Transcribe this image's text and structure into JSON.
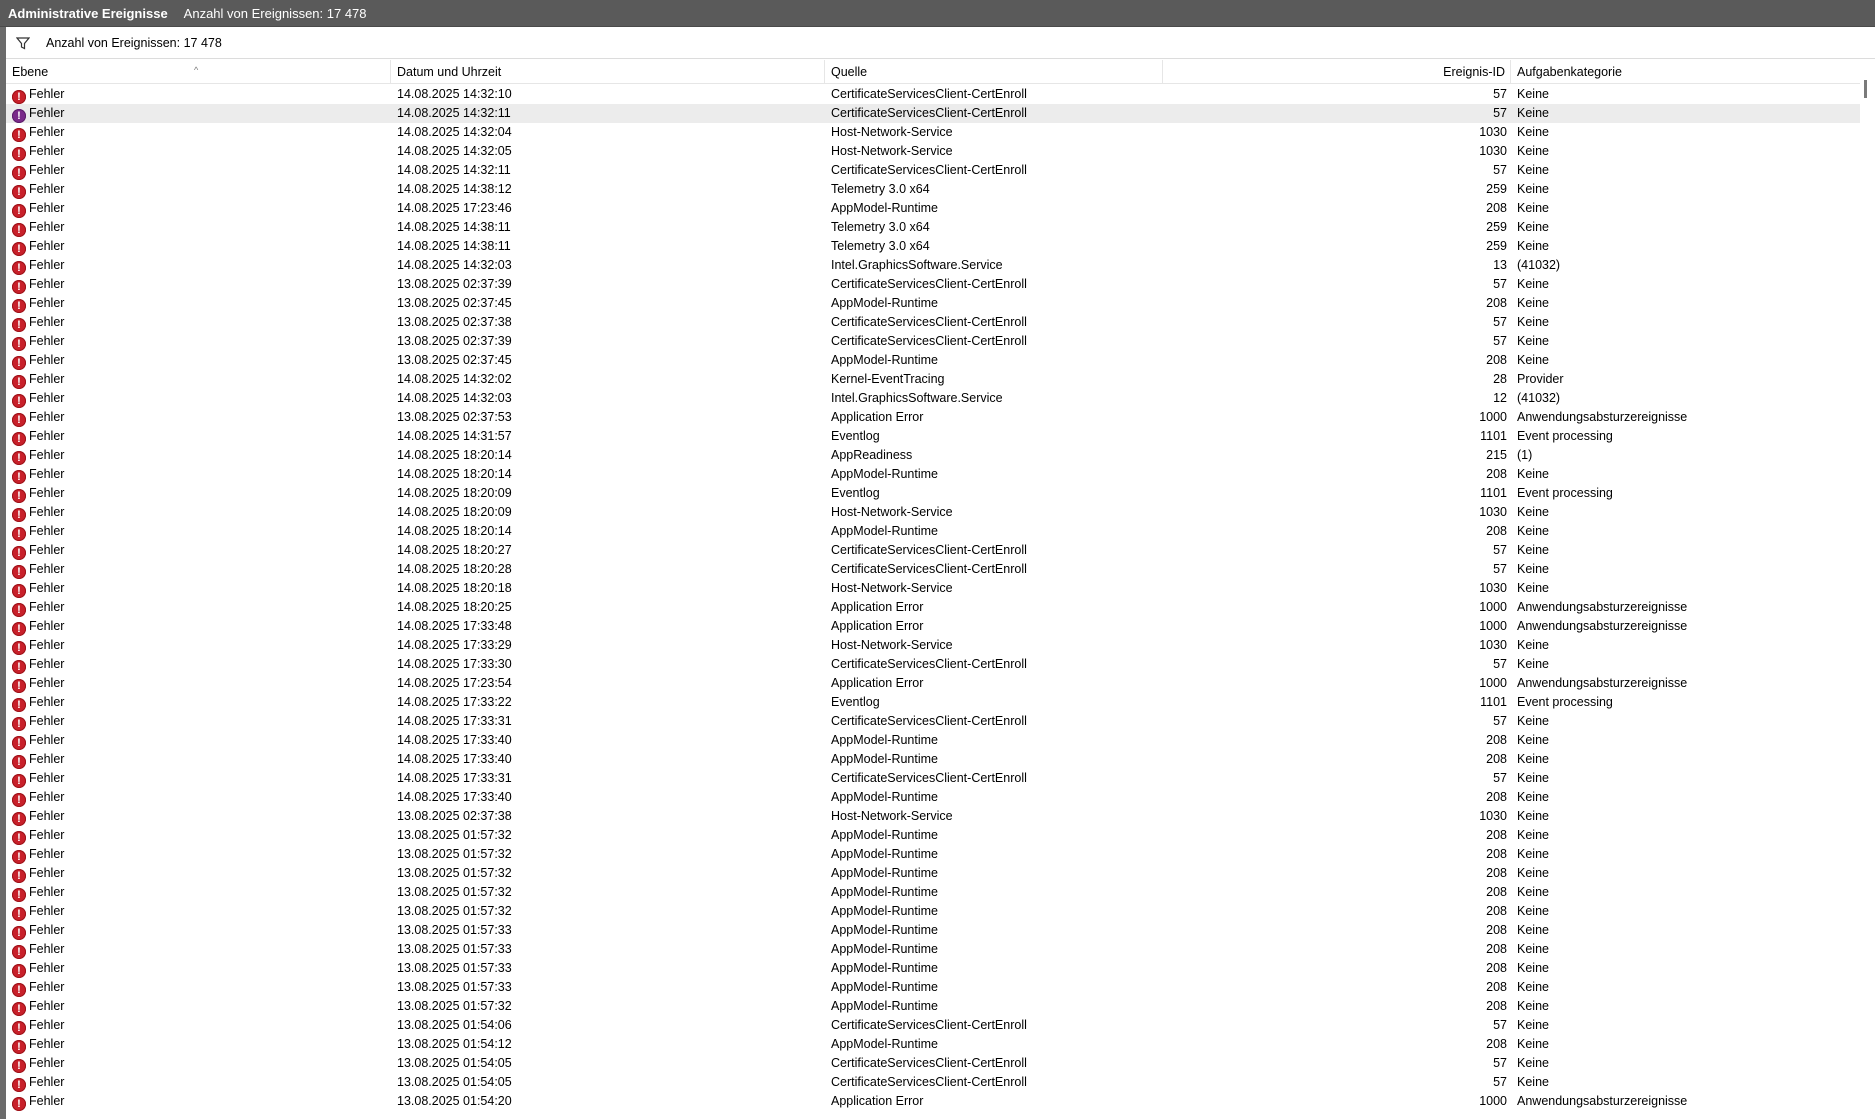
{
  "title_bar": {
    "title": "Administrative Ereignisse",
    "count_label": "Anzahl von Ereignissen: 17 478"
  },
  "filter_bar": {
    "icon": "filter-icon",
    "text": "Anzahl von Ereignissen: 17 478"
  },
  "columns": [
    "Ebene",
    "Datum und Uhrzeit",
    "Quelle",
    "Ereignis-ID",
    "Aufgabenkategorie"
  ],
  "rows": [
    {
      "level": "Fehler",
      "date": "14.08.2025 14:32:10",
      "source": "CertificateServicesClient-CertEnroll",
      "id": "57",
      "category": "Keine"
    },
    {
      "level": "Fehler",
      "date": "14.08.2025 14:32:11",
      "source": "CertificateServicesClient-CertEnroll",
      "id": "57",
      "category": "Keine"
    },
    {
      "level": "Fehler",
      "date": "14.08.2025 14:32:04",
      "source": "Host-Network-Service",
      "id": "1030",
      "category": "Keine"
    },
    {
      "level": "Fehler",
      "date": "14.08.2025 14:32:05",
      "source": "Host-Network-Service",
      "id": "1030",
      "category": "Keine"
    },
    {
      "level": "Fehler",
      "date": "14.08.2025 14:32:11",
      "source": "CertificateServicesClient-CertEnroll",
      "id": "57",
      "category": "Keine"
    },
    {
      "level": "Fehler",
      "date": "14.08.2025 14:38:12",
      "source": "Telemetry 3.0 x64",
      "id": "259",
      "category": "Keine"
    },
    {
      "level": "Fehler",
      "date": "14.08.2025 17:23:46",
      "source": "AppModel-Runtime",
      "id": "208",
      "category": "Keine"
    },
    {
      "level": "Fehler",
      "date": "14.08.2025 14:38:11",
      "source": "Telemetry 3.0 x64",
      "id": "259",
      "category": "Keine"
    },
    {
      "level": "Fehler",
      "date": "14.08.2025 14:38:11",
      "source": "Telemetry 3.0 x64",
      "id": "259",
      "category": "Keine"
    },
    {
      "level": "Fehler",
      "date": "14.08.2025 14:32:03",
      "source": "Intel.GraphicsSoftware.Service",
      "id": "13",
      "category": "(41032)"
    },
    {
      "level": "Fehler",
      "date": "13.08.2025 02:37:39",
      "source": "CertificateServicesClient-CertEnroll",
      "id": "57",
      "category": "Keine"
    },
    {
      "level": "Fehler",
      "date": "13.08.2025 02:37:45",
      "source": "AppModel-Runtime",
      "id": "208",
      "category": "Keine"
    },
    {
      "level": "Fehler",
      "date": "13.08.2025 02:37:38",
      "source": "CertificateServicesClient-CertEnroll",
      "id": "57",
      "category": "Keine"
    },
    {
      "level": "Fehler",
      "date": "13.08.2025 02:37:39",
      "source": "CertificateServicesClient-CertEnroll",
      "id": "57",
      "category": "Keine"
    },
    {
      "level": "Fehler",
      "date": "13.08.2025 02:37:45",
      "source": "AppModel-Runtime",
      "id": "208",
      "category": "Keine"
    },
    {
      "level": "Fehler",
      "date": "14.08.2025 14:32:02",
      "source": "Kernel-EventTracing",
      "id": "28",
      "category": "Provider"
    },
    {
      "level": "Fehler",
      "date": "14.08.2025 14:32:03",
      "source": "Intel.GraphicsSoftware.Service",
      "id": "12",
      "category": "(41032)"
    },
    {
      "level": "Fehler",
      "date": "13.08.2025 02:37:53",
      "source": "Application Error",
      "id": "1000",
      "category": "Anwendungsabsturzereignisse"
    },
    {
      "level": "Fehler",
      "date": "14.08.2025 14:31:57",
      "source": "Eventlog",
      "id": "1101",
      "category": "Event processing"
    },
    {
      "level": "Fehler",
      "date": "14.08.2025 18:20:14",
      "source": "AppReadiness",
      "id": "215",
      "category": "(1)"
    },
    {
      "level": "Fehler",
      "date": "14.08.2025 18:20:14",
      "source": "AppModel-Runtime",
      "id": "208",
      "category": "Keine"
    },
    {
      "level": "Fehler",
      "date": "14.08.2025 18:20:09",
      "source": "Eventlog",
      "id": "1101",
      "category": "Event processing"
    },
    {
      "level": "Fehler",
      "date": "14.08.2025 18:20:09",
      "source": "Host-Network-Service",
      "id": "1030",
      "category": "Keine"
    },
    {
      "level": "Fehler",
      "date": "14.08.2025 18:20:14",
      "source": "AppModel-Runtime",
      "id": "208",
      "category": "Keine"
    },
    {
      "level": "Fehler",
      "date": "14.08.2025 18:20:27",
      "source": "CertificateServicesClient-CertEnroll",
      "id": "57",
      "category": "Keine"
    },
    {
      "level": "Fehler",
      "date": "14.08.2025 18:20:28",
      "source": "CertificateServicesClient-CertEnroll",
      "id": "57",
      "category": "Keine"
    },
    {
      "level": "Fehler",
      "date": "14.08.2025 18:20:18",
      "source": "Host-Network-Service",
      "id": "1030",
      "category": "Keine"
    },
    {
      "level": "Fehler",
      "date": "14.08.2025 18:20:25",
      "source": "Application Error",
      "id": "1000",
      "category": "Anwendungsabsturzereignisse"
    },
    {
      "level": "Fehler",
      "date": "14.08.2025 17:33:48",
      "source": "Application Error",
      "id": "1000",
      "category": "Anwendungsabsturzereignisse"
    },
    {
      "level": "Fehler",
      "date": "14.08.2025 17:33:29",
      "source": "Host-Network-Service",
      "id": "1030",
      "category": "Keine"
    },
    {
      "level": "Fehler",
      "date": "14.08.2025 17:33:30",
      "source": "CertificateServicesClient-CertEnroll",
      "id": "57",
      "category": "Keine"
    },
    {
      "level": "Fehler",
      "date": "14.08.2025 17:23:54",
      "source": "Application Error",
      "id": "1000",
      "category": "Anwendungsabsturzereignisse"
    },
    {
      "level": "Fehler",
      "date": "14.08.2025 17:33:22",
      "source": "Eventlog",
      "id": "1101",
      "category": "Event processing"
    },
    {
      "level": "Fehler",
      "date": "14.08.2025 17:33:31",
      "source": "CertificateServicesClient-CertEnroll",
      "id": "57",
      "category": "Keine"
    },
    {
      "level": "Fehler",
      "date": "14.08.2025 17:33:40",
      "source": "AppModel-Runtime",
      "id": "208",
      "category": "Keine"
    },
    {
      "level": "Fehler",
      "date": "14.08.2025 17:33:40",
      "source": "AppModel-Runtime",
      "id": "208",
      "category": "Keine"
    },
    {
      "level": "Fehler",
      "date": "14.08.2025 17:33:31",
      "source": "CertificateServicesClient-CertEnroll",
      "id": "57",
      "category": "Keine"
    },
    {
      "level": "Fehler",
      "date": "14.08.2025 17:33:40",
      "source": "AppModel-Runtime",
      "id": "208",
      "category": "Keine"
    },
    {
      "level": "Fehler",
      "date": "13.08.2025 02:37:38",
      "source": "Host-Network-Service",
      "id": "1030",
      "category": "Keine"
    },
    {
      "level": "Fehler",
      "date": "13.08.2025 01:57:32",
      "source": "AppModel-Runtime",
      "id": "208",
      "category": "Keine"
    },
    {
      "level": "Fehler",
      "date": "13.08.2025 01:57:32",
      "source": "AppModel-Runtime",
      "id": "208",
      "category": "Keine"
    },
    {
      "level": "Fehler",
      "date": "13.08.2025 01:57:32",
      "source": "AppModel-Runtime",
      "id": "208",
      "category": "Keine"
    },
    {
      "level": "Fehler",
      "date": "13.08.2025 01:57:32",
      "source": "AppModel-Runtime",
      "id": "208",
      "category": "Keine"
    },
    {
      "level": "Fehler",
      "date": "13.08.2025 01:57:32",
      "source": "AppModel-Runtime",
      "id": "208",
      "category": "Keine"
    },
    {
      "level": "Fehler",
      "date": "13.08.2025 01:57:33",
      "source": "AppModel-Runtime",
      "id": "208",
      "category": "Keine"
    },
    {
      "level": "Fehler",
      "date": "13.08.2025 01:57:33",
      "source": "AppModel-Runtime",
      "id": "208",
      "category": "Keine"
    },
    {
      "level": "Fehler",
      "date": "13.08.2025 01:57:33",
      "source": "AppModel-Runtime",
      "id": "208",
      "category": "Keine"
    },
    {
      "level": "Fehler",
      "date": "13.08.2025 01:57:33",
      "source": "AppModel-Runtime",
      "id": "208",
      "category": "Keine"
    },
    {
      "level": "Fehler",
      "date": "13.08.2025 01:57:32",
      "source": "AppModel-Runtime",
      "id": "208",
      "category": "Keine"
    },
    {
      "level": "Fehler",
      "date": "13.08.2025 01:54:06",
      "source": "CertificateServicesClient-CertEnroll",
      "id": "57",
      "category": "Keine"
    },
    {
      "level": "Fehler",
      "date": "13.08.2025 01:54:12",
      "source": "AppModel-Runtime",
      "id": "208",
      "category": "Keine"
    },
    {
      "level": "Fehler",
      "date": "13.08.2025 01:54:05",
      "source": "CertificateServicesClient-CertEnroll",
      "id": "57",
      "category": "Keine"
    },
    {
      "level": "Fehler",
      "date": "13.08.2025 01:54:05",
      "source": "CertificateServicesClient-CertEnroll",
      "id": "57",
      "category": "Keine"
    },
    {
      "level": "Fehler",
      "date": "13.08.2025 01:54:20",
      "source": "Application Error",
      "id": "1000",
      "category": "Anwendungsabsturzereignisse"
    }
  ],
  "selected_row": 1,
  "colors": {
    "error_icon": "#c8202a",
    "selected_row_icon": "#7a2a8a",
    "selected_row_bg": "#ececec",
    "title_bar": "#5a5a5a"
  }
}
